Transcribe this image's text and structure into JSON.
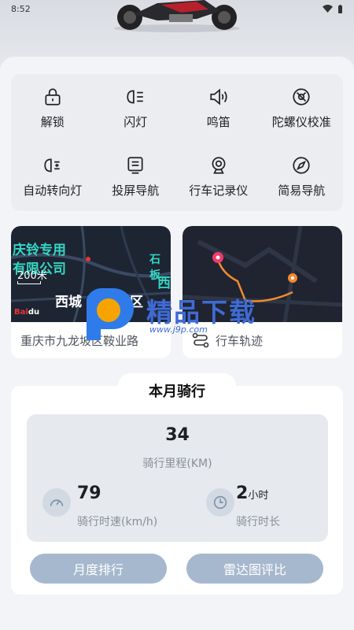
{
  "status_bar": {
    "time": "8:52"
  },
  "controls": [
    {
      "label": "解锁",
      "icon": "lock-icon"
    },
    {
      "label": "闪灯",
      "icon": "headlight-icon"
    },
    {
      "label": "鸣笛",
      "icon": "horn-icon"
    },
    {
      "label": "陀螺仪校准",
      "icon": "gyroscope-icon"
    },
    {
      "label": "自动转向灯",
      "icon": "turn-signal-icon"
    },
    {
      "label": "投屏导航",
      "icon": "screen-cast-icon"
    },
    {
      "label": "行车记录仪",
      "icon": "dashcam-icon"
    },
    {
      "label": "简易导航",
      "icon": "compass-icon"
    }
  ],
  "map_card": {
    "address": "重庆市九龙坡区鞍业路",
    "map_labels": [
      "庆铃专用",
      "有限公司",
      "石板",
      "西",
      "西城",
      "西区"
    ],
    "scale": "200米"
  },
  "track_card": {
    "label": "行车轨迹"
  },
  "watermark": {
    "name": "精品下载",
    "url": "www.j9p.com"
  },
  "monthly": {
    "title": "本月骑行",
    "distance_value": "34",
    "distance_label": "骑行里程(KM)",
    "speed_value": "79",
    "speed_label": "骑行时速(km/h)",
    "duration_value": "2",
    "duration_unit": "小时",
    "duration_label": "骑行时长"
  },
  "buttons": {
    "ranking": "月度排行",
    "radar": "雷达图评比"
  },
  "colors": {
    "accent_button": "#a6b8cd",
    "watermark_blue": "#3f6bd6",
    "map_teal": "#35d6c3"
  }
}
